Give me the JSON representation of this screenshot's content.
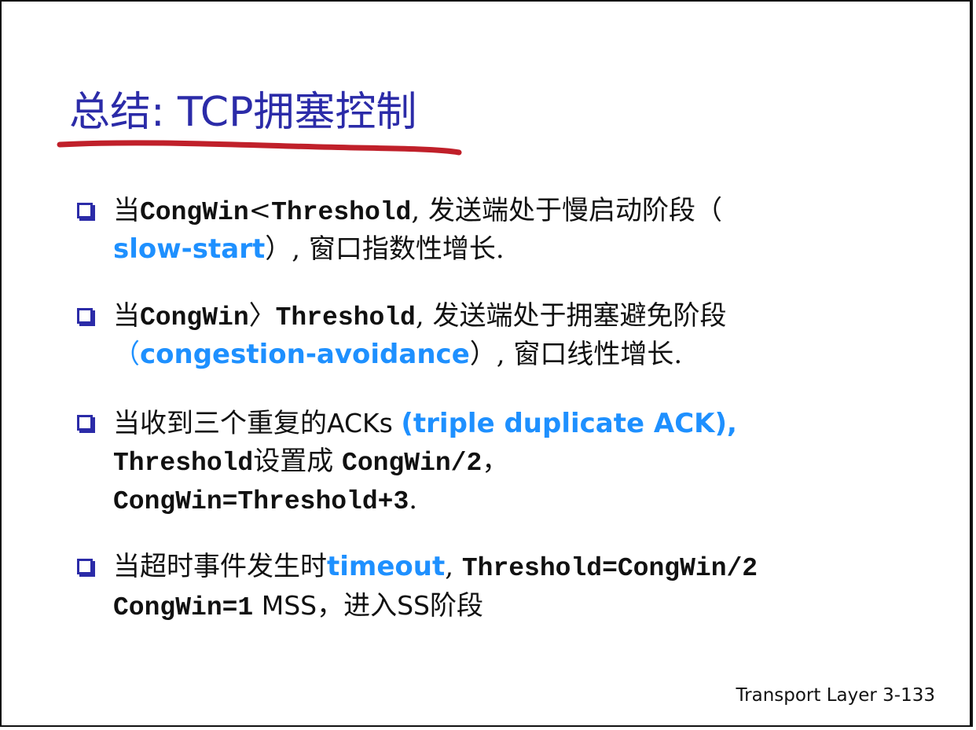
{
  "title": "总结: TCP拥塞控制",
  "colors": {
    "title": "#2b2ba8",
    "underline": "#c0202a",
    "term": "#1e90ff",
    "bullet": "#2b2ba8",
    "text": "#111111"
  },
  "bullets": [
    {
      "line1": {
        "p1": "当",
        "p2": "CongWin",
        "p3": "<",
        "p4": "Threshold",
        "p5": ", 发送端处于慢启动阶段（"
      },
      "line2": {
        "p1": "slow-start",
        "p2": "）, 窗口指数性增长."
      }
    },
    {
      "line1": {
        "p1": "当",
        "p2": "CongWin",
        "p3": "〉",
        "p4": "Threshold",
        "p5": ", 发送端处于拥塞避免阶段"
      },
      "line2": {
        "p1": "（",
        "p2": "congestion-avoidance",
        "p3": "）, 窗口线性增长."
      }
    },
    {
      "line1": {
        "p1": "当收到三个重复的",
        "p2": "ACKs ",
        "p3": "(triple duplicate ACK),"
      },
      "line2": {
        "p1": "Threshold",
        "p2": "设置成 ",
        "p3": "CongWin/2",
        "p4": "，"
      },
      "line3": {
        "p1": "CongWin=Threshold+3",
        "p2": "."
      }
    },
    {
      "line1": {
        "p1": "当超时事件发生时",
        "p2": "timeout",
        "p3": ", ",
        "p4": "Threshold=CongWin/2"
      },
      "line2": {
        "p1": "CongWin=1",
        "p2": " MSS",
        "p3": "，进入",
        "p4": "SS",
        "p5": "阶段"
      }
    }
  ],
  "footer": "Transport Layer  3-133"
}
